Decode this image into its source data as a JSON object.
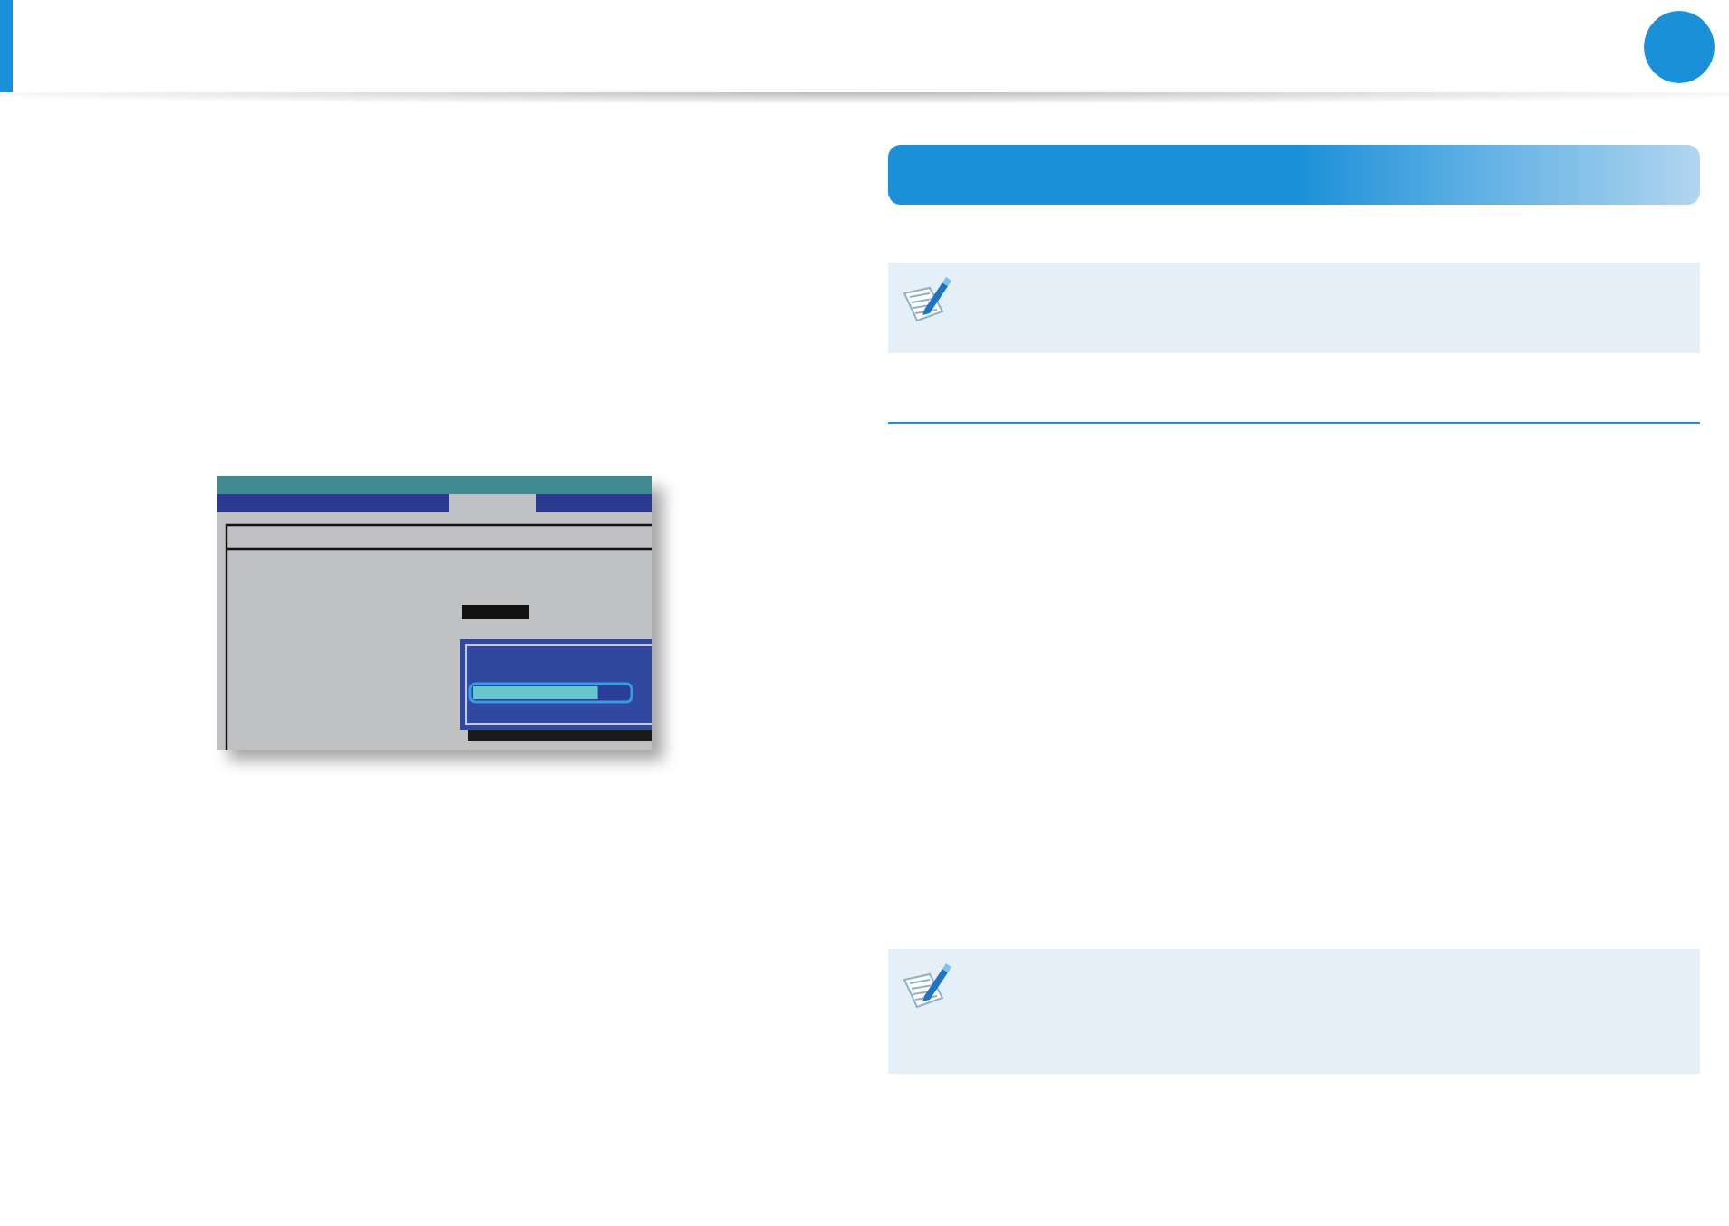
{
  "bios_screenshot": {
    "progress_bar": {
      "level": 0.8
    }
  }
}
